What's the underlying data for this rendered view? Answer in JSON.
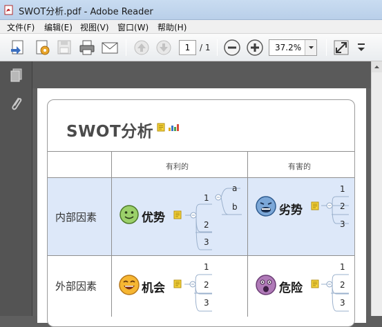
{
  "window": {
    "title": "SWOT分析.pdf - Adobe Reader"
  },
  "menu": {
    "items": [
      "文件(F)",
      "编辑(E)",
      "视图(V)",
      "窗口(W)",
      "帮助(H)"
    ]
  },
  "toolbar": {
    "current_page": "1",
    "total_pages": "/ 1",
    "zoom": "37.2%"
  },
  "document": {
    "title": "SWOT分析",
    "columns": [
      "有利的",
      "有害的"
    ],
    "rows": [
      "内部因素",
      "外部因素"
    ],
    "cells": {
      "strengths": {
        "label": "优势",
        "branch1": "1",
        "sub_a": "a",
        "sub_b": "b",
        "branch2": "2",
        "branch3": "3"
      },
      "weaknesses": {
        "label": "劣势",
        "b1": "1",
        "b2": "2",
        "b3": "3"
      },
      "opportunities": {
        "label": "机会",
        "b1": "1",
        "b2": "2",
        "b3": "3"
      },
      "threats": {
        "label": "危险",
        "b1": "1",
        "b2": "2",
        "b3": "3"
      }
    }
  },
  "colors": {
    "row_highlight": "#dde8f9",
    "note_yellow": "#f3d23a",
    "accent_blue": "#3a6fb7"
  }
}
